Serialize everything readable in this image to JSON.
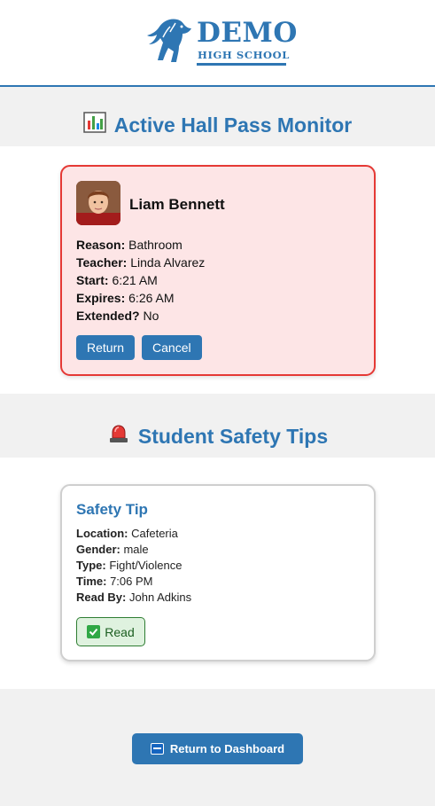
{
  "header": {
    "logo_main": "DEMO",
    "logo_sub": "HIGH SCHOOL"
  },
  "hall_pass_section": {
    "title": "Active Hall Pass Monitor",
    "icon": "bar-chart-icon",
    "pass": {
      "student_name": "Liam Bennett",
      "reason_label": "Reason:",
      "reason": "Bathroom",
      "teacher_label": "Teacher:",
      "teacher": "Linda Alvarez",
      "start_label": "Start:",
      "start": "6:21 AM",
      "expires_label": "Expires:",
      "expires": "6:26 AM",
      "extended_label": "Extended?",
      "extended": "No",
      "return_label": "Return",
      "cancel_label": "Cancel"
    }
  },
  "safety_section": {
    "title": "Student Safety Tips",
    "icon": "siren-icon",
    "tip": {
      "title": "Safety Tip",
      "location_label": "Location:",
      "location": "Cafeteria",
      "gender_label": "Gender:",
      "gender": "male",
      "type_label": "Type:",
      "type": "Fight/Violence",
      "time_label": "Time:",
      "time": "7:06 PM",
      "read_by_label": "Read By:",
      "read_by": "John Adkins",
      "read_badge": "Read"
    }
  },
  "footer": {
    "dashboard_button": "Return to Dashboard"
  },
  "colors": {
    "brand": "#2e76b3",
    "alert_border": "#e53935",
    "alert_bg": "#fde5e6",
    "read_green": "#2e7d32"
  }
}
